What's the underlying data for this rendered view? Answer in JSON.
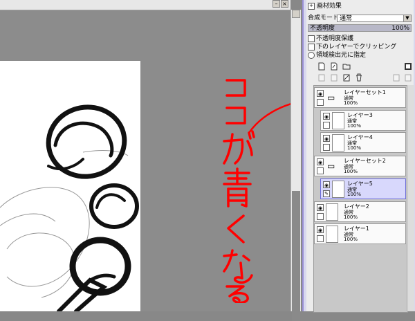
{
  "colors": {
    "accent": "#9a8fd6",
    "selected_layer": "#d8d8fc",
    "annotation": "#ff0000"
  },
  "panel": {
    "title": "画材効果",
    "blend_mode_label": "合成モード",
    "blend_mode_value": "通常",
    "opacity_label": "不透明度",
    "opacity_value": "100%",
    "options": [
      {
        "label": "不透明度保護",
        "type": "checkbox"
      },
      {
        "label": "下のレイヤーでクリッピング",
        "type": "checkbox"
      },
      {
        "label": "領域検出元に指定",
        "type": "radio"
      }
    ]
  },
  "layers": [
    {
      "name": "レイヤーセット1",
      "mode": "通常",
      "opacity": "100%",
      "type": "folder",
      "indent": 0,
      "selected": false
    },
    {
      "name": "レイヤー3",
      "mode": "通常",
      "opacity": "100%",
      "type": "layer",
      "indent": 1,
      "selected": false
    },
    {
      "name": "レイヤー4",
      "mode": "通常",
      "opacity": "100%",
      "type": "layer",
      "indent": 1,
      "selected": false
    },
    {
      "name": "レイヤーセット2",
      "mode": "通常",
      "opacity": "100%",
      "type": "folder",
      "indent": 0,
      "selected": false
    },
    {
      "name": "レイヤー5",
      "mode": "通常",
      "opacity": "100%",
      "type": "layer",
      "indent": 1,
      "selected": true
    },
    {
      "name": "レイヤー2",
      "mode": "通常",
      "opacity": "100%",
      "type": "layer",
      "indent": 0,
      "selected": false
    },
    {
      "name": "レイヤー1",
      "mode": "通常",
      "opacity": "100%",
      "type": "layer",
      "indent": 0,
      "selected": false
    }
  ],
  "annotation": {
    "text": "ココが青くなる"
  },
  "icons": [
    "new-layer-icon",
    "new-vector-layer-icon",
    "new-folder-icon",
    "layer-to-mask-icon",
    "delete-icon",
    "pen-icon",
    "eye-icon"
  ]
}
